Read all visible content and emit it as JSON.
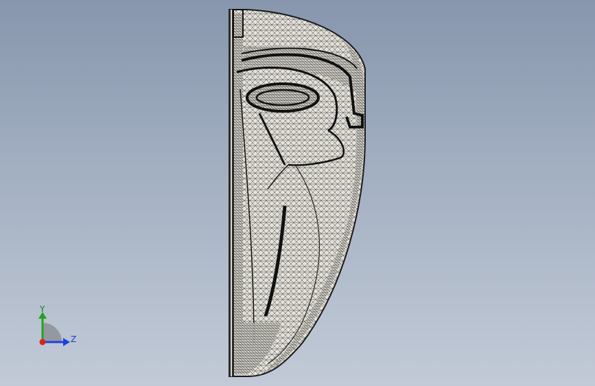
{
  "viewport": {
    "background_top": "#8796ad",
    "background_bottom": "#c2cad7",
    "model": {
      "description_icon": "mesh-half-mask-model",
      "fill_color": "#e6e3db",
      "edge_color": "#1a1a1a"
    }
  },
  "triad": {
    "y_label": "Y",
    "z_label": "Z",
    "y_color": "#1fa31f",
    "z_color": "#1f3fe0",
    "x_color": "#e01f1f"
  }
}
